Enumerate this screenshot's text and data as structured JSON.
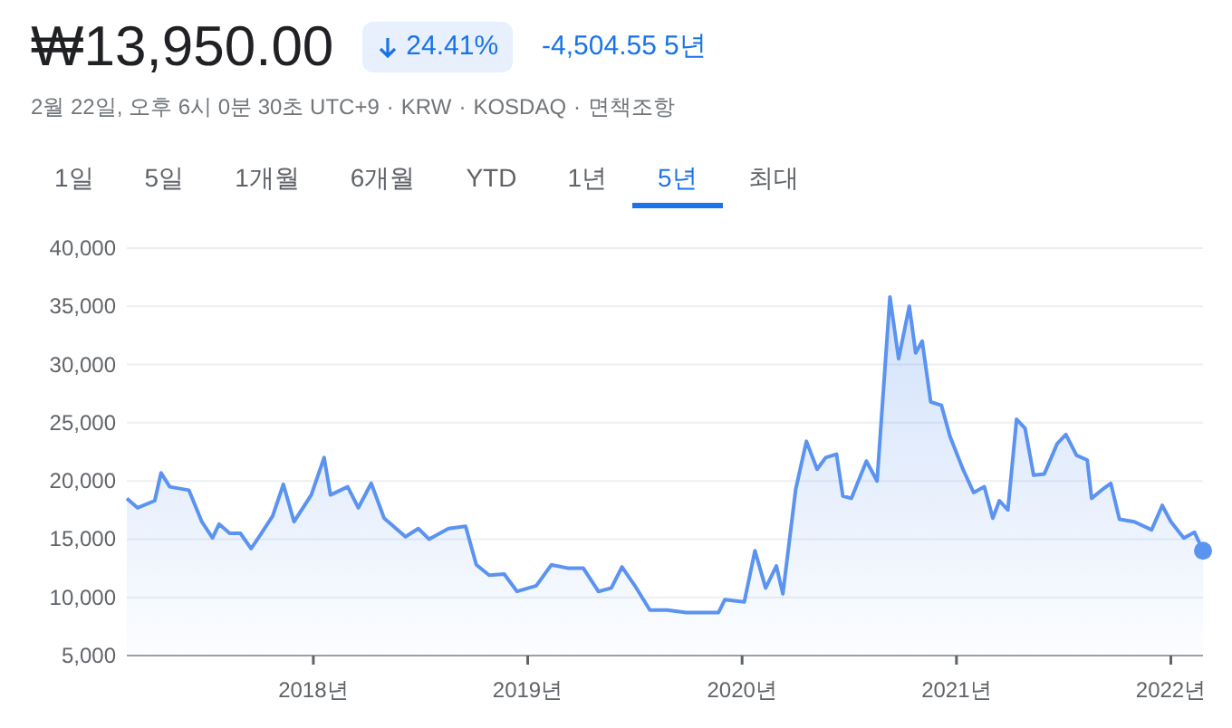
{
  "quote": {
    "price": "₩13,950.00",
    "change_percent": "24.41%",
    "falling": true,
    "change_value": "-4,504.55",
    "period": "5년"
  },
  "meta": {
    "items": [
      "2월 22일, 오후 6시 0분 30초 UTC+9",
      "KRW",
      "KOSDAQ"
    ],
    "separator": "·",
    "disclaimer": "면책조항"
  },
  "tabs": [
    {
      "label": "1일",
      "selected": false
    },
    {
      "label": "5일",
      "selected": false
    },
    {
      "label": "1개월",
      "selected": false
    },
    {
      "label": "6개월",
      "selected": false
    },
    {
      "label": "YTD",
      "selected": false
    },
    {
      "label": "1년",
      "selected": false
    },
    {
      "label": "5년",
      "selected": true
    },
    {
      "label": "최대",
      "selected": false
    }
  ],
  "chart": {
    "chart_data": {
      "type": "area",
      "x": [
        2017.13,
        2017.18,
        2017.26,
        2017.29,
        2017.33,
        2017.42,
        2017.48,
        2017.53,
        2017.56,
        2017.61,
        2017.66,
        2017.71,
        2017.75,
        2017.81,
        2017.86,
        2017.91,
        2017.99,
        2018.05,
        2018.08,
        2018.16,
        2018.21,
        2018.27,
        2018.33,
        2018.43,
        2018.49,
        2018.54,
        2018.63,
        2018.71,
        2018.76,
        2018.82,
        2018.89,
        2018.95,
        2019.04,
        2019.11,
        2019.19,
        2019.26,
        2019.33,
        2019.39,
        2019.44,
        2019.5,
        2019.57,
        2019.65,
        2019.74,
        2019.81,
        2019.89,
        2019.92,
        2020.01,
        2020.06,
        2020.11,
        2020.16,
        2020.19,
        2020.25,
        2020.3,
        2020.35,
        2020.39,
        2020.44,
        2020.47,
        2020.51,
        2020.58,
        2020.63,
        2020.66,
        2020.69,
        2020.73,
        2020.78,
        2020.81,
        2020.84,
        2020.88,
        2020.93,
        2020.97,
        2021.03,
        2021.08,
        2021.13,
        2021.17,
        2021.2,
        2021.24,
        2021.28,
        2021.32,
        2021.36,
        2021.41,
        2021.47,
        2021.51,
        2021.56,
        2021.61,
        2021.63,
        2021.69,
        2021.72,
        2021.76,
        2021.83,
        2021.91,
        2021.96,
        2022.0,
        2022.06,
        2022.11,
        2022.15
      ],
      "grid": true,
      "series": [
        {
          "color": "#5b93f0",
          "values": [
            18500,
            17700,
            18300,
            20700,
            19500,
            19200,
            16500,
            15100,
            16300,
            15500,
            15500,
            14200,
            15300,
            17000,
            19700,
            16500,
            18800,
            22000,
            18800,
            19500,
            17700,
            19800,
            16800,
            15200,
            15900,
            15000,
            15900,
            16100,
            12800,
            11900,
            12000,
            10500,
            11000,
            12800,
            12500,
            12500,
            10500,
            10800,
            12600,
            11000,
            8900,
            8900,
            8700,
            8700,
            8700,
            9800,
            9600,
            14000,
            10800,
            12700,
            10300,
            19300,
            23400,
            21000,
            22000,
            22300,
            18700,
            18500,
            21700,
            20000,
            28000,
            35800,
            30500,
            35000,
            31000,
            32000,
            26800,
            26500,
            23800,
            21000,
            19000,
            19500,
            16800,
            18300,
            17500,
            25300,
            24500,
            20500,
            20600,
            23200,
            24000,
            22200,
            21800,
            18500,
            19400,
            19800,
            16700,
            16500,
            15800,
            17900,
            16500,
            15100,
            15600,
            14000
          ]
        }
      ],
      "xlim": [
        2017.13,
        2022.15
      ],
      "ylim": [
        5000,
        40000
      ],
      "xticks": [
        {
          "value": 2018,
          "label": "2018년"
        },
        {
          "value": 2019,
          "label": "2019년"
        },
        {
          "value": 2020,
          "label": "2020년"
        },
        {
          "value": 2021,
          "label": "2021년"
        },
        {
          "value": 2022,
          "label": "2022년"
        }
      ],
      "yticks": [
        {
          "value": 5000,
          "label": "5,000"
        },
        {
          "value": 10000,
          "label": "10,000"
        },
        {
          "value": 15000,
          "label": "15,000"
        },
        {
          "value": 20000,
          "label": "20,000"
        },
        {
          "value": 25000,
          "label": "25,000"
        },
        {
          "value": 30000,
          "label": "30,000"
        },
        {
          "value": 35000,
          "label": "35,000"
        },
        {
          "value": 40000,
          "label": "40,000"
        }
      ]
    }
  }
}
